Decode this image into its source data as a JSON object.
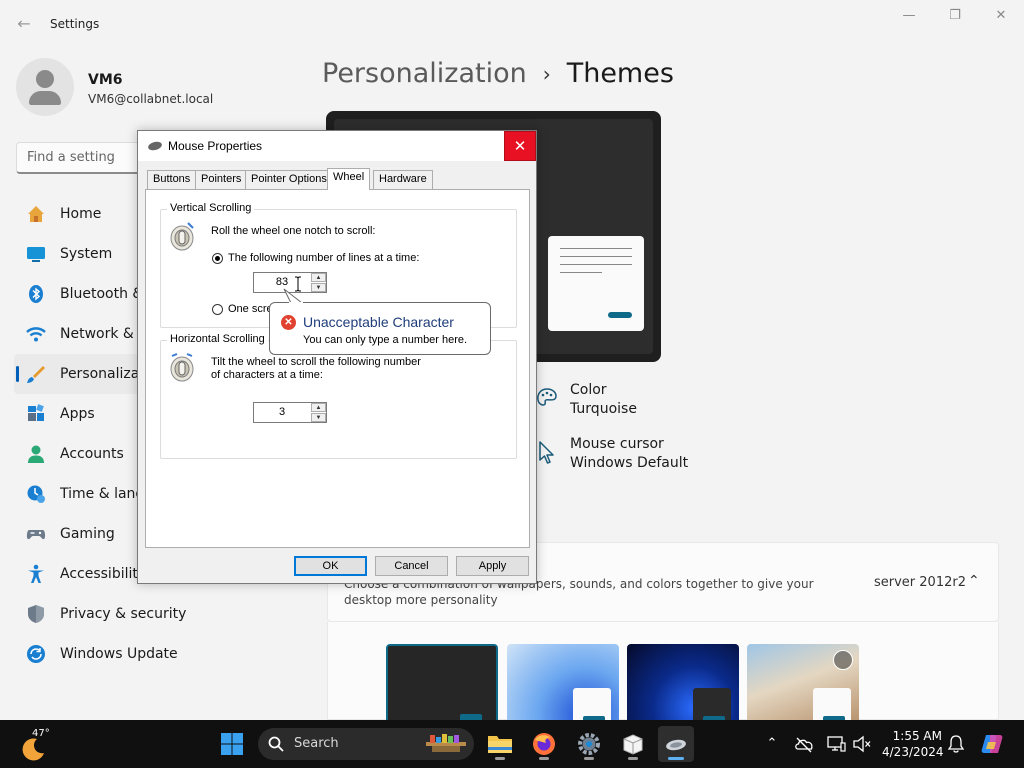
{
  "settings": {
    "app_title": "Settings",
    "user": {
      "name": "VM6",
      "email": "VM6@collabnet.local"
    },
    "search_placeholder": "Find a setting",
    "nav": [
      {
        "label": "Home"
      },
      {
        "label": "System"
      },
      {
        "label": "Bluetooth &"
      },
      {
        "label": "Network & i"
      },
      {
        "label": "Personalizati"
      },
      {
        "label": "Apps"
      },
      {
        "label": "Accounts"
      },
      {
        "label": "Time & langu"
      },
      {
        "label": "Gaming"
      },
      {
        "label": "Accessibility"
      },
      {
        "label": "Privacy & security"
      },
      {
        "label": "Windows Update"
      }
    ],
    "breadcrumb": {
      "parent": "Personalization",
      "separator": "›",
      "current": "Themes"
    },
    "properties": [
      {
        "title": "Color",
        "value": "Turquoise"
      },
      {
        "title": "Mouse cursor",
        "value": "Windows Default"
      }
    ],
    "current_theme": {
      "description": "Choose a combination of wallpapers, sounds, and colors together to give your desktop more personality",
      "value": "server 2012r2"
    }
  },
  "dialog": {
    "title": "Mouse Properties",
    "close": "✕",
    "tabs": [
      "Buttons",
      "Pointers",
      "Pointer Options",
      "Wheel",
      "Hardware"
    ],
    "selected_tab": "Wheel",
    "vertical": {
      "label": "Vertical Scrolling",
      "instruction": "Roll the wheel one notch to scroll:",
      "option_lines": "The following number of lines at a time:",
      "lines_value": "83",
      "option_screen": "One scre"
    },
    "horizontal": {
      "label": "Horizontal Scrolling",
      "instruction_1": "Tilt the wheel to scroll the following number",
      "instruction_2": "of characters at a time:",
      "chars_value": "3"
    },
    "buttons": {
      "ok": "OK",
      "cancel": "Cancel",
      "apply": "Apply"
    }
  },
  "balloon": {
    "title": "Unacceptable Character",
    "message": "You can only type a number here."
  },
  "taskbar": {
    "weather_temp": "47°",
    "search_label": "Search",
    "time": "1:55 AM",
    "date": "4/23/2024"
  },
  "colors": {
    "accent": "#005fb8",
    "error": "#e0422f",
    "close": "#e81123",
    "theme_accent": "#0f6a8a"
  }
}
